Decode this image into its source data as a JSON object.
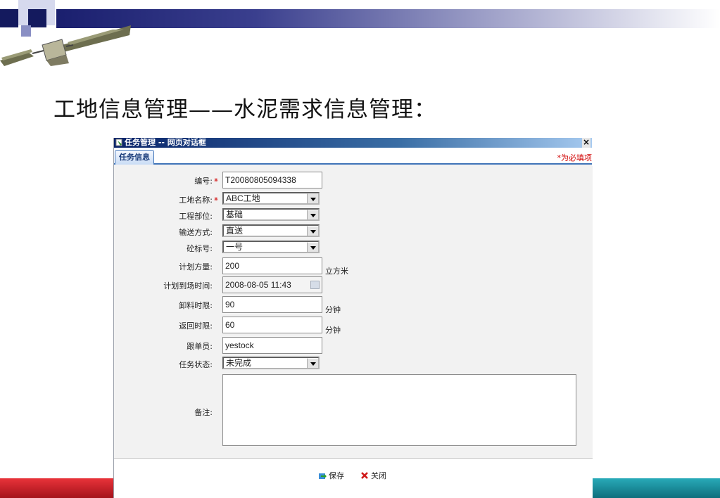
{
  "slide": {
    "title": "工地信息管理——水泥需求信息管理："
  },
  "dialog": {
    "window_title": "任务管理 -- 网页对话框",
    "close_glyph": "×",
    "tab": "任务信息",
    "required_note": "*为必填项",
    "required_mark": "*",
    "fields": {
      "number": {
        "label": "编号:",
        "value": "T20080805094338"
      },
      "site_name": {
        "label": "工地名称:",
        "value": "ABC工地"
      },
      "project_part": {
        "label": "工程部位:",
        "value": "基础"
      },
      "transport": {
        "label": "输送方式:",
        "value": "直送"
      },
      "grade": {
        "label": "砼标号:",
        "value": "一号"
      },
      "planned_volume": {
        "label": "计划方量:",
        "value": "200",
        "unit": "立方米"
      },
      "arrival_time": {
        "label": "计划到场时间:",
        "value": "2008-08-05 11:43"
      },
      "unload_limit": {
        "label": "卸料时限:",
        "value": "90",
        "unit": "分钟"
      },
      "return_limit": {
        "label": "返回时限:",
        "value": "60",
        "unit": "分钟"
      },
      "follower": {
        "label": "跟单员:",
        "value": "yestock"
      },
      "task_status": {
        "label": "任务状态:",
        "value": "未完成"
      },
      "remarks": {
        "label": "备注:",
        "value": ""
      }
    },
    "buttons": {
      "save": "保存",
      "close": "关闭"
    }
  },
  "colors": {
    "title_bar": "#0a246a",
    "tab_border": "#3f74b8",
    "required": "#d00000",
    "bottom_red": "#c4161c",
    "bottom_teal": "#1a8c9a"
  }
}
